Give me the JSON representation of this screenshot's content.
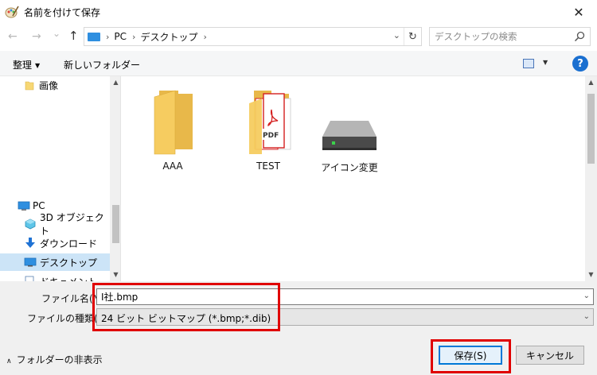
{
  "window": {
    "title": "名前を付けて保存",
    "close": "✕"
  },
  "address": {
    "back": "←",
    "forward": "→",
    "recent": "⌄",
    "up": "↑",
    "crumbs": [
      "PC",
      "デスクトップ"
    ],
    "sep": "›",
    "dropdown": "⌄",
    "refresh": "↻",
    "search_placeholder": "デスクトップの検索"
  },
  "toolbar": {
    "organize": "整理",
    "organize_caret": "▼",
    "new_folder": "新しいフォルダー",
    "view_caret": "▼",
    "help": "?"
  },
  "nav": {
    "items": [
      {
        "label": "画像",
        "icon": "picture-folder-icon"
      },
      {
        "label": "PC",
        "icon": "pc-icon"
      },
      {
        "label": "3D オブジェクト",
        "icon": "3d-objects-icon"
      },
      {
        "label": "ダウンロード",
        "icon": "download-icon"
      },
      {
        "label": "デスクトップ",
        "icon": "desktop-icon",
        "selected": true
      },
      {
        "label": "ドキュメント",
        "icon": "documents-icon"
      }
    ]
  },
  "files": [
    {
      "name": "AAA",
      "type": "folder"
    },
    {
      "name": "TEST",
      "type": "folder-with-pdf"
    },
    {
      "name": "アイコン変更",
      "type": "drive"
    }
  ],
  "pdf_label": "PDF",
  "save_form": {
    "filename_label": "ファイル名(N):",
    "filename_value": "I社.bmp",
    "filetype_label": "ファイルの種類(T):",
    "filetype_value": "24 ビット ビットマップ (*.bmp;*.dib)",
    "dropdown": "⌄"
  },
  "footer": {
    "hide_folders": "フォルダーの非表示",
    "hide_chevron": "∧",
    "save": "保存(S)",
    "cancel": "キャンセル"
  },
  "colors": {
    "highlight": "#e00000",
    "selection": "#cce4f7",
    "accent": "#0078d7"
  }
}
